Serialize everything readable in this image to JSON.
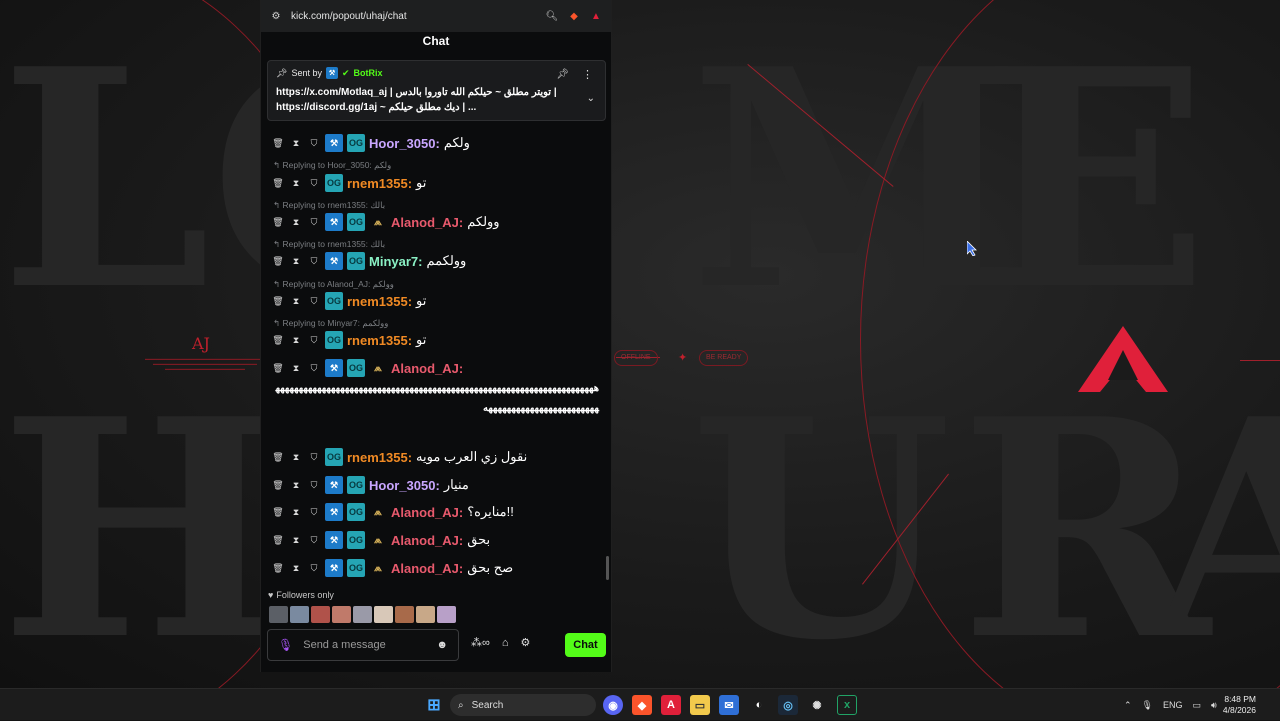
{
  "browser": {
    "url": "kick.com/popout/uhaj/chat",
    "chat_title": "Chat"
  },
  "pinned": {
    "sent_by_label": "Sent by",
    "sender": "BotRix",
    "line1": "https://x.com/Motlaq_aj | تويتر مطلق ~ حيلكم الله تاوروا بالدس |",
    "line2": "https://discord.gg/1aj ~ ديك مطلق حيلكم | ..."
  },
  "messages": [
    {
      "user": "Hoor_3050",
      "color": "hoor",
      "text": "ولكم",
      "reply": ""
    },
    {
      "user": "rnem1355",
      "color": "rnem",
      "text": "تو",
      "reply": "Replying to Hoor_3050: ولكم"
    },
    {
      "user": "Alanod_AJ",
      "color": "alanod",
      "text": "وولكم",
      "reply": "Replying to rnem1355: بالك"
    },
    {
      "user": "Minyar7",
      "color": "minyar",
      "text": "وولكمم",
      "reply": "Replying to rnem1355: بالك"
    },
    {
      "user": "rnem1355",
      "color": "rnem",
      "text": "تو",
      "reply": "Replying to Alanod_AJ: وولكم"
    },
    {
      "user": "rnem1355",
      "color": "rnem",
      "text": "تو",
      "reply": "Replying to Minyar7: وولكمم"
    },
    {
      "user": "Alanod_AJ",
      "color": "alanod",
      "text": "",
      "reply": ""
    },
    {
      "user": "rnem1355",
      "color": "rnem",
      "text": "نقول زي العرب مويه",
      "reply": ""
    },
    {
      "user": "Hoor_3050",
      "color": "hoor",
      "text": "منيار",
      "reply": ""
    },
    {
      "user": "Alanod_AJ",
      "color": "alanod",
      "text": "!!منايره؟",
      "reply": ""
    },
    {
      "user": "Alanod_AJ",
      "color": "alanod",
      "text": "بحق",
      "reply": ""
    },
    {
      "user": "Alanod_AJ",
      "color": "alanod",
      "text": "صح بحق",
      "reply": ""
    }
  ],
  "long_message": "ههههههههههههههههههههههههههههههههههههههههههههههههههههههههههههههههههههههههههههههههههههههههههههههه",
  "followers_only": "Followers only",
  "composer": {
    "placeholder": "Send a message",
    "send_label": "Chat"
  },
  "taskbar": {
    "search_label": "Search",
    "lang": "ENG",
    "time": "8:48 PM",
    "date": "4/8/2026"
  },
  "desktop": {
    "left_logo": "AJ",
    "pill_left": "OFFLINE",
    "pill_right": "BE READY"
  },
  "colors": {
    "accent": "#53fc18",
    "brand_red": "#e0203a"
  }
}
